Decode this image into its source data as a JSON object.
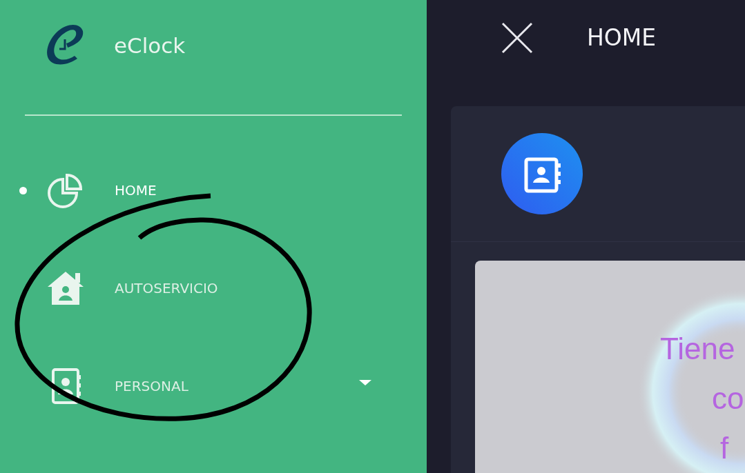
{
  "sidebar": {
    "app_name": "eClock",
    "items": [
      {
        "label": "HOME",
        "kind": "link",
        "selected": true
      },
      {
        "label": "AUTOSERVICIO",
        "kind": "link",
        "selected": false
      },
      {
        "label": "PERSONAL",
        "kind": "group",
        "selected": false
      }
    ]
  },
  "header": {
    "title": "HOME"
  },
  "card": {
    "text_lines": [
      "Tiene",
      "co",
      "f"
    ]
  }
}
